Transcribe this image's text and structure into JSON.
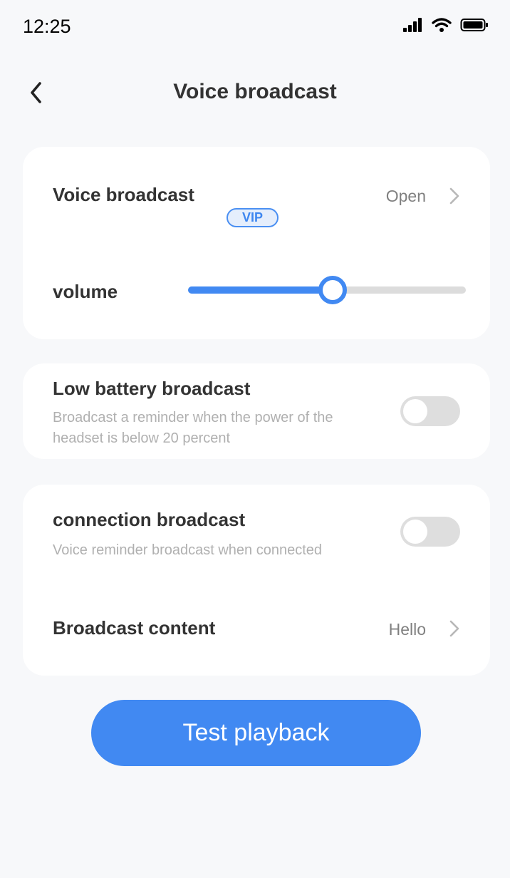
{
  "status_bar": {
    "time": "12:25",
    "icons": [
      "signal-icon",
      "wifi-icon",
      "battery-icon"
    ]
  },
  "nav": {
    "back_icon": "chevron-left-icon",
    "title": "Voice broadcast"
  },
  "voice_card": {
    "broadcast": {
      "label": "Voice broadcast",
      "badge": "VIP",
      "value": "Open"
    },
    "volume": {
      "label": "volume",
      "level": 0.52
    }
  },
  "low_battery": {
    "title": "Low battery broadcast",
    "description_line1": "Broadcast a reminder when the power of the",
    "description_line2": "headset is below 20 percent",
    "enabled": false
  },
  "connection": {
    "title": "connection broadcast",
    "description": "Voice reminder broadcast when connected",
    "enabled": false,
    "content_label": "Broadcast content",
    "content_value": "Hello"
  },
  "actions": {
    "test_label": "Test playback"
  },
  "colors": {
    "accent": "#4189f2",
    "background": "#f7f8fa",
    "card": "#ffffff",
    "toggle_off": "#dedede",
    "secondary_text": "#b0b0b0"
  }
}
